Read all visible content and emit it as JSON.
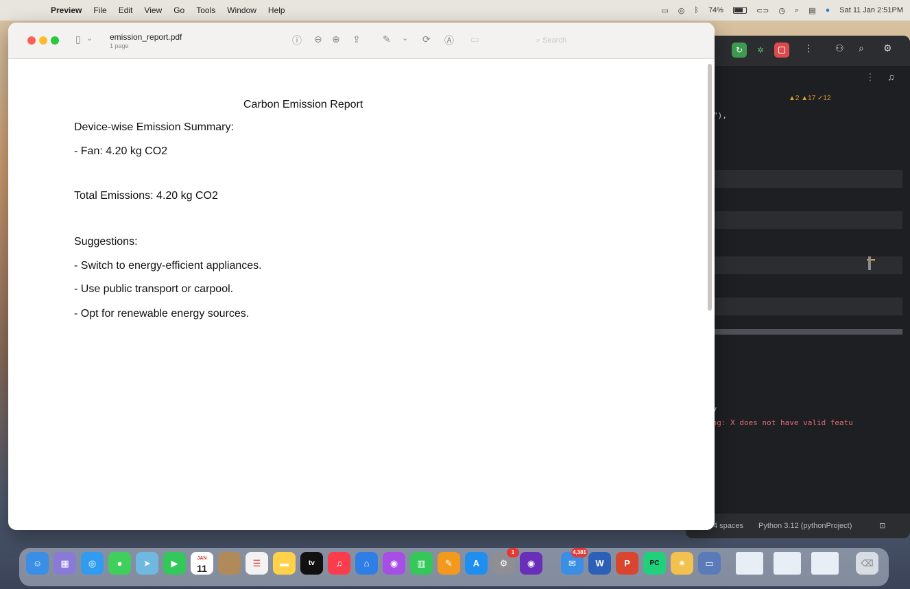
{
  "menubar": {
    "apple_icon": "",
    "app_name": "Preview",
    "items": [
      "File",
      "Edit",
      "View",
      "Go",
      "Tools",
      "Window",
      "Help"
    ],
    "battery": "74%",
    "datetime": "Sat 11 Jan 2:51PM"
  },
  "preview": {
    "filename": "emission_report.pdf",
    "page_count": "1 page",
    "search_placeholder": "Search",
    "document": {
      "title": "Carbon Emission Report",
      "summary_heading": "Device-wise Emission Summary:",
      "devices": [
        "- Fan: 4.20 kg CO2"
      ],
      "total": "Total Emissions: 4.20 kg CO2",
      "suggestions_heading": "Suggestions:",
      "suggestions": [
        "- Switch to energy-efficient appliances.",
        "- Use public transport or carpool.",
        "- Opt for renewable energy sources."
      ]
    }
  },
  "ide": {
    "warnings": "▲2 ▲17 ✓12",
    "code_snippet": "\"),",
    "terminal_line_1": "py",
    "terminal_line_2": "ing: X does not have valid featu",
    "status_indent": "4 spaces",
    "status_interpreter": "Python 3.12 (pythonProject)"
  },
  "dock": {
    "calendar_day": "11",
    "calendar_month": "JAN",
    "mail_badge": "4,381",
    "appstore_badge": "1",
    "tv_label": "tv"
  },
  "colors": {
    "menubar_bg": "#e8e4de",
    "ide_bg": "#1e1f22",
    "ide_run": "#3d9a50",
    "ide_stop": "#db4b4b",
    "terminal_error": "#e06c75"
  }
}
